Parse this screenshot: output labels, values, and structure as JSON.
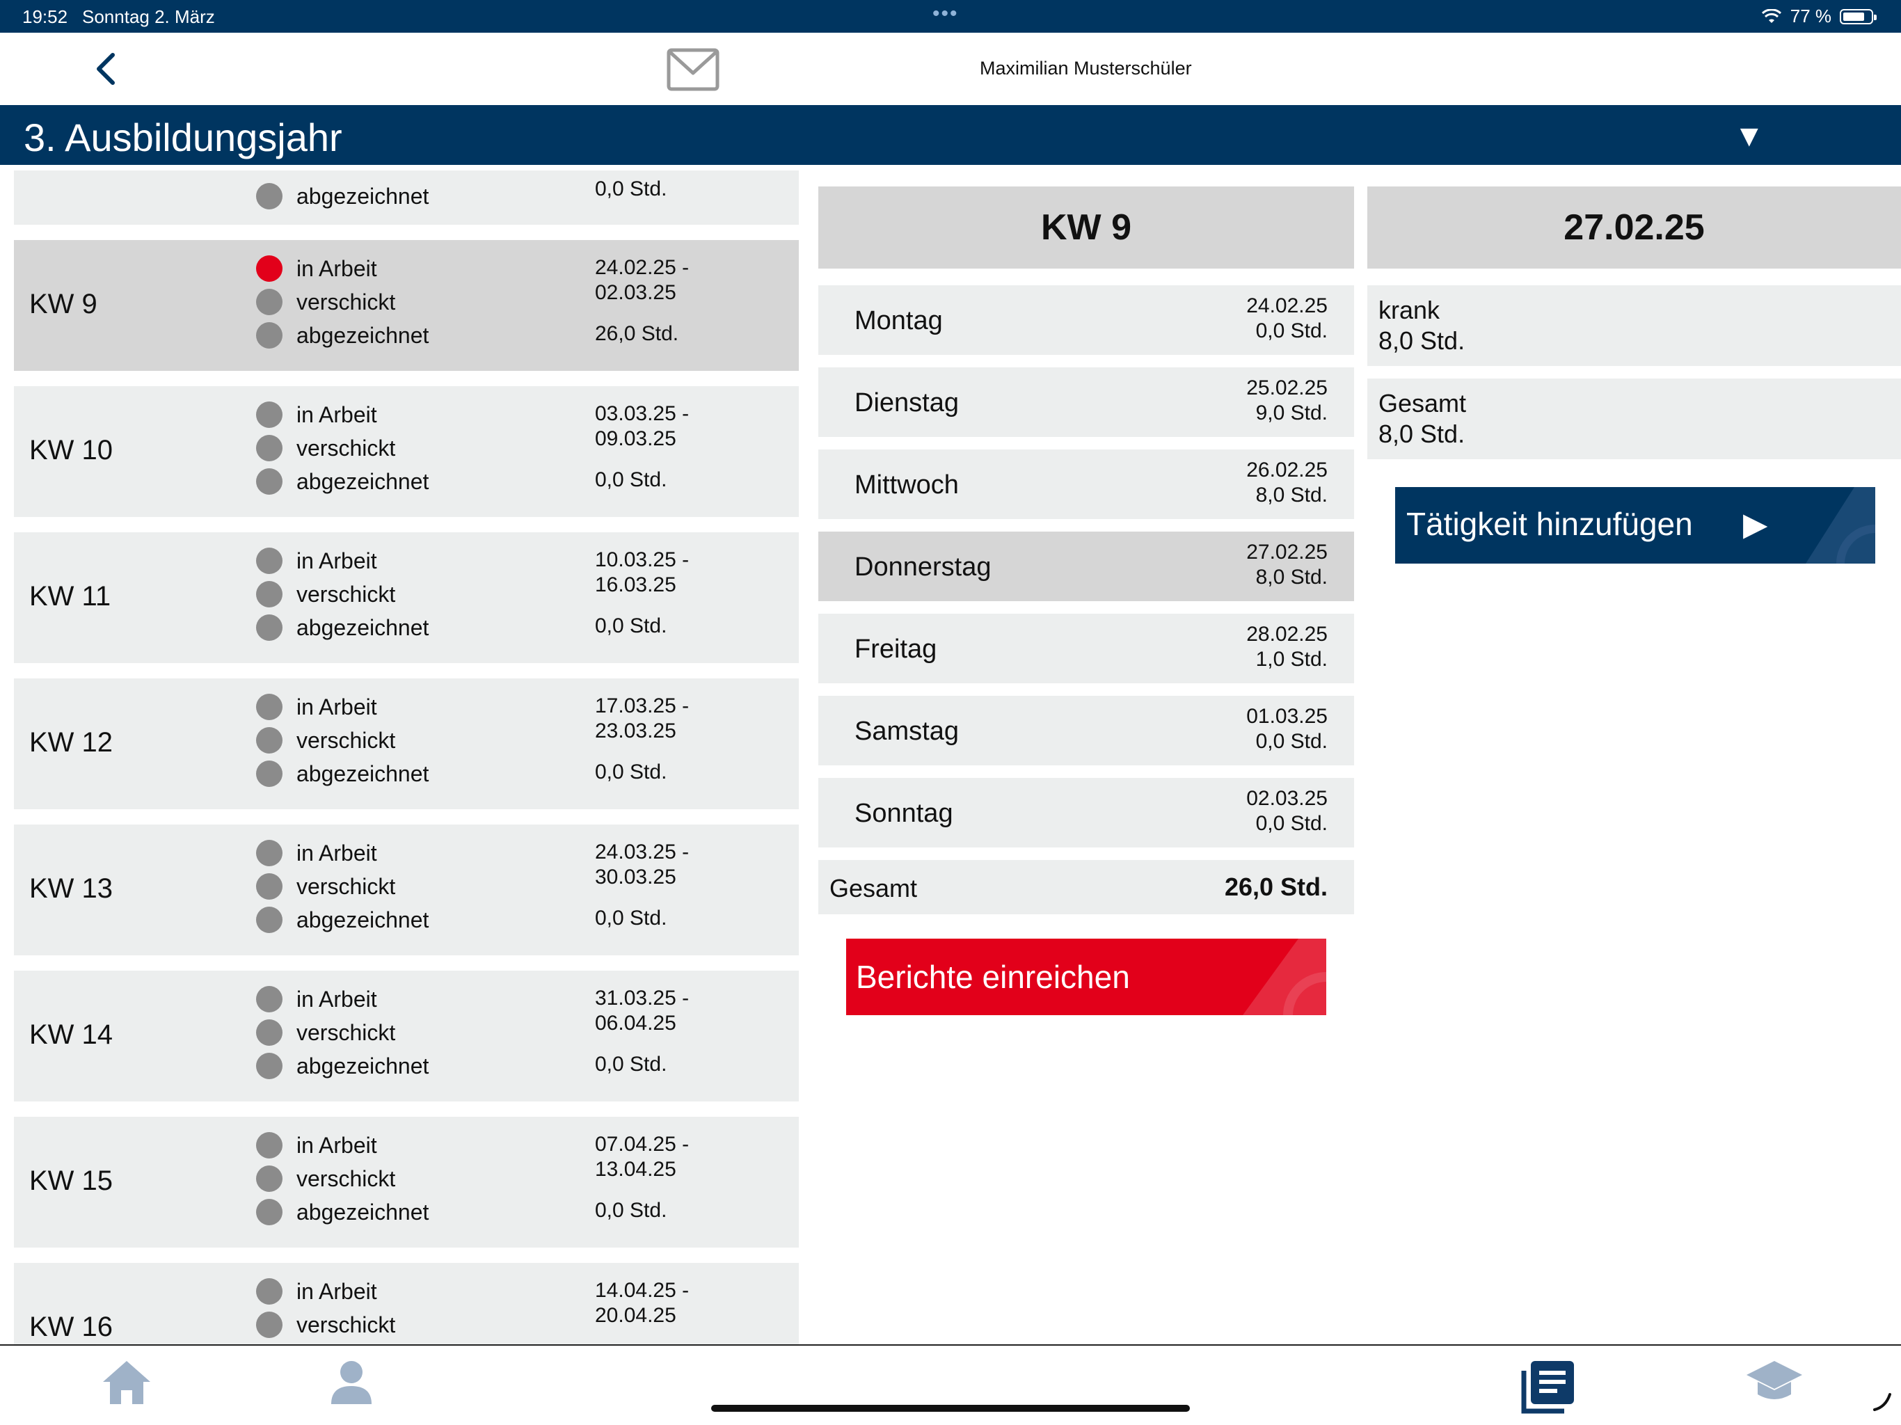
{
  "status_bar": {
    "time": "19:52",
    "date": "Sonntag 2. März",
    "dots": "•••",
    "battery": "77 %"
  },
  "header": {
    "user_name": "Maximilian Musterschüler",
    "icons": [
      "back-chevron-icon",
      "mail-icon"
    ]
  },
  "year_selector": {
    "title": "3. Ausbildungsjahr",
    "caret": "▼"
  },
  "weeks": {
    "partial_top": {
      "status_abgezeichnet": "abgezeichnet",
      "hours": "0,0 Std."
    },
    "items": [
      {
        "label": "KW 9",
        "s1": "in Arbeit",
        "s2": "verschickt",
        "s3": "abgezeichnet",
        "range1": "24.02.25 -",
        "range2": "02.03.25",
        "hours": "26,0 Std.",
        "active": true
      },
      {
        "label": "KW 10",
        "s1": "in Arbeit",
        "s2": "verschickt",
        "s3": "abgezeichnet",
        "range1": "03.03.25 -",
        "range2": "09.03.25",
        "hours": "0,0 Std."
      },
      {
        "label": "KW 11",
        "s1": "in Arbeit",
        "s2": "verschickt",
        "s3": "abgezeichnet",
        "range1": "10.03.25 -",
        "range2": "16.03.25",
        "hours": "0,0 Std."
      },
      {
        "label": "KW 12",
        "s1": "in Arbeit",
        "s2": "verschickt",
        "s3": "abgezeichnet",
        "range1": "17.03.25 -",
        "range2": "23.03.25",
        "hours": "0,0 Std."
      },
      {
        "label": "KW 13",
        "s1": "in Arbeit",
        "s2": "verschickt",
        "s3": "abgezeichnet",
        "range1": "24.03.25 -",
        "range2": "30.03.25",
        "hours": "0,0 Std."
      },
      {
        "label": "KW 14",
        "s1": "in Arbeit",
        "s2": "verschickt",
        "s3": "abgezeichnet",
        "range1": "31.03.25 -",
        "range2": "06.04.25",
        "hours": "0,0 Std."
      },
      {
        "label": "KW 15",
        "s1": "in Arbeit",
        "s2": "verschickt",
        "s3": "abgezeichnet",
        "range1": "07.04.25 -",
        "range2": "13.04.25",
        "hours": "0,0 Std."
      },
      {
        "label": "KW 16",
        "s1": "in Arbeit",
        "s2": "verschickt",
        "range1": "14.04.25 -",
        "range2": "20.04.25"
      }
    ]
  },
  "week_detail": {
    "title": "KW 9",
    "days": [
      {
        "name": "Montag",
        "date": "24.02.25",
        "hours": "0,0 Std."
      },
      {
        "name": "Dienstag",
        "date": "25.02.25",
        "hours": "9,0 Std."
      },
      {
        "name": "Mittwoch",
        "date": "26.02.25",
        "hours": "8,0 Std."
      },
      {
        "name": "Donnerstag",
        "date": "27.02.25",
        "hours": "8,0 Std.",
        "active": true
      },
      {
        "name": "Freitag",
        "date": "28.02.25",
        "hours": "1,0 Std."
      },
      {
        "name": "Samstag",
        "date": "01.03.25",
        "hours": "0,0 Std."
      },
      {
        "name": "Sonntag",
        "date": "02.03.25",
        "hours": "0,0 Std."
      }
    ],
    "total_label": "Gesamt",
    "total_value": "26,0 Std.",
    "submit_label": "Berichte einreichen"
  },
  "day_detail": {
    "title": "27.02.25",
    "activity_name": "krank",
    "activity_hours": "8,0 Std.",
    "total_label": "Gesamt",
    "total_hours": "8,0 Std.",
    "add_label": "Tätigkeit hinzufügen",
    "add_arrow": "▶"
  },
  "tabbar": {
    "icons": [
      "home-icon",
      "profile-icon",
      "reports-icon",
      "education-icon"
    ]
  },
  "colors": {
    "primary": "#003560",
    "accent_red": "#e2001a",
    "card_bg": "#eceeee",
    "card_active_bg": "#d6d6d6",
    "dot_gray": "#8b8b8b",
    "tab_icon_gray": "#9fb2c8"
  }
}
